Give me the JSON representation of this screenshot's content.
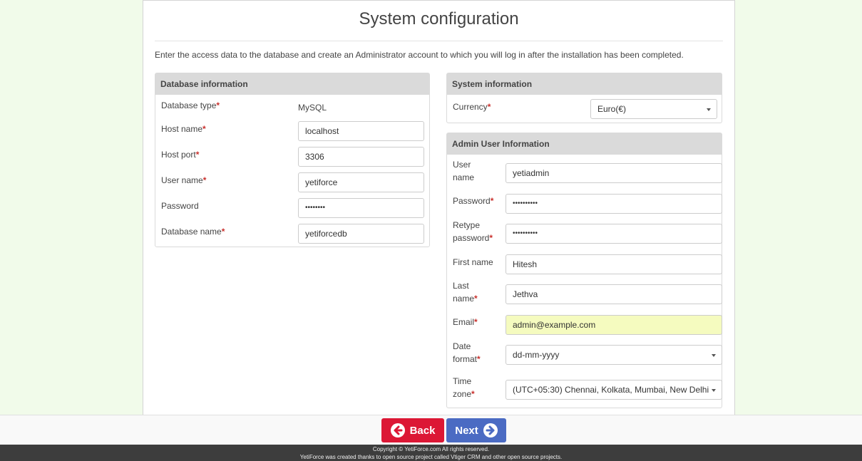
{
  "header": {
    "title": "System configuration",
    "intro": "Enter the access data to the database and create an Administrator account to which you will log in after the installation has been completed."
  },
  "database": {
    "heading": "Database information",
    "type_label": "Database type",
    "type_value": "MySQL",
    "host_label": "Host name",
    "host_value": "localhost",
    "port_label": "Host port",
    "port_value": "3306",
    "user_label": "User name",
    "user_value": "yetiforce",
    "password_label": "Password",
    "password_value": "••••••••",
    "dbname_label": "Database name",
    "dbname_value": "yetiforcedb"
  },
  "system": {
    "heading": "System information",
    "currency_label": "Currency",
    "currency_value": "Euro(€)"
  },
  "admin": {
    "heading": "Admin User Information",
    "username_label_1": "User",
    "username_label_2": "name",
    "username_value": "yetiadmin",
    "password_label": "Password",
    "password_value": "••••••••••",
    "retype_label_1": "Retype",
    "retype_label_2": "password",
    "retype_value": "••••••••••",
    "firstname_label": "First name",
    "firstname_value": "Hitesh",
    "lastname_label_1": "Last",
    "lastname_label_2": "name",
    "lastname_value": "Jethva",
    "email_label": "Email",
    "email_value": "admin@example.com",
    "dateformat_label_1": "Date",
    "dateformat_label_2": "format",
    "dateformat_value": "dd-mm-yyyy",
    "timezone_label_1": "Time",
    "timezone_label_2": "zone",
    "timezone_value": "(UTC+05:30) Chennai, Kolkata, Mumbai, New Delhi"
  },
  "buttons": {
    "back": "Back",
    "next": "Next"
  },
  "footer": {
    "line1": "Copyright © YetiForce.com All rights reserved.",
    "line2": "YetiForce was created thanks to open source project called Vtiger CRM and other open source projects."
  },
  "colors": {
    "back_button": "#dc1735",
    "next_button": "#4b6bc3",
    "required": "#c9302c",
    "email_highlight": "#f5fbbf"
  },
  "icons": {
    "back": "arrow-left-circle-icon",
    "next": "arrow-right-circle-icon",
    "select": "caret-down-icon"
  }
}
